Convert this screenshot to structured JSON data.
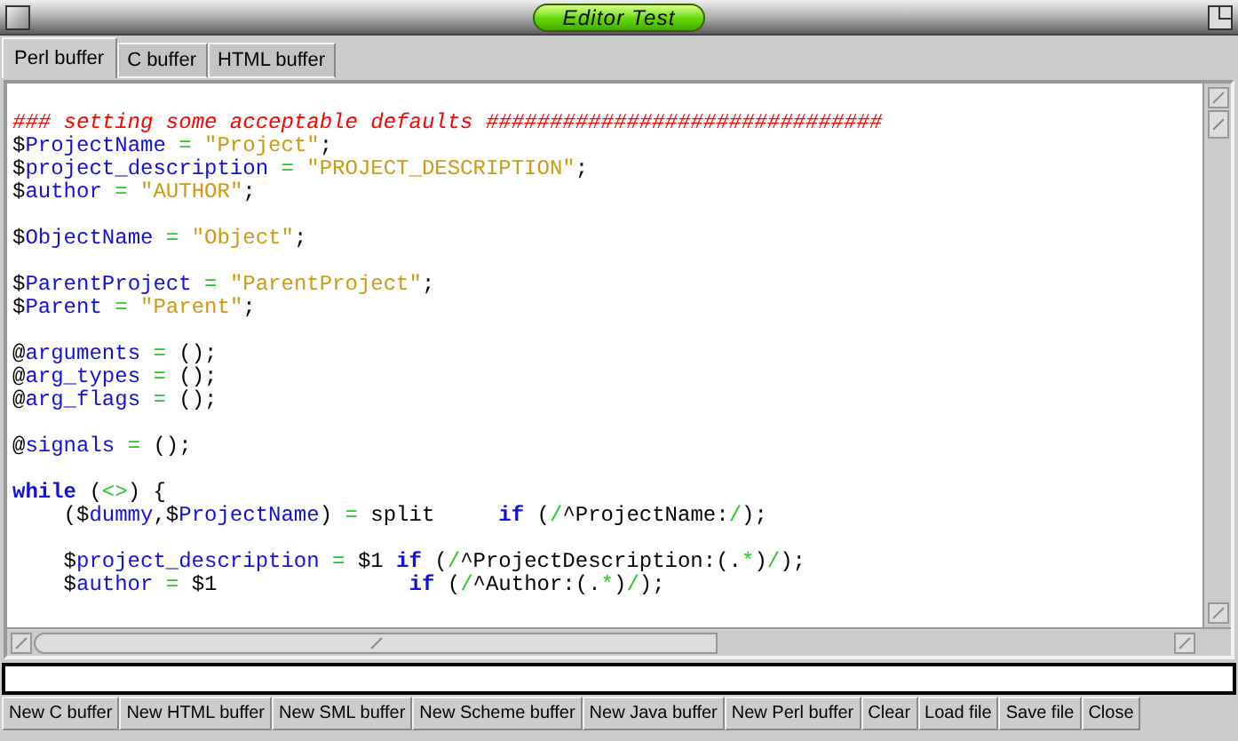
{
  "window": {
    "title": "Editor Test"
  },
  "tabs": [
    {
      "label": "Perl buffer",
      "selected": true
    },
    {
      "label": "C buffer",
      "selected": false
    },
    {
      "label": "HTML buffer",
      "selected": false
    }
  ],
  "code_lines": [
    {
      "kind": "code",
      "tokens": [
        {
          "kind": "comment",
          "text": "### setting some acceptable defaults ###############################"
        }
      ]
    },
    {
      "kind": "code",
      "tokens": [
        {
          "kind": "var",
          "text": "$ProjectName"
        },
        {
          "kind": "op",
          "text": " = "
        },
        {
          "kind": "str",
          "text": "\"Project\""
        },
        {
          "kind": "plain",
          "text": ";"
        }
      ]
    },
    {
      "kind": "code",
      "tokens": [
        {
          "kind": "var",
          "text": "$project_description"
        },
        {
          "kind": "op",
          "text": " = "
        },
        {
          "kind": "str",
          "text": "\"PROJECT_DESCRIPTION\""
        },
        {
          "kind": "plain",
          "text": ";"
        }
      ]
    },
    {
      "kind": "code",
      "tokens": [
        {
          "kind": "var",
          "text": "$author"
        },
        {
          "kind": "op",
          "text": " = "
        },
        {
          "kind": "str",
          "text": "\"AUTHOR\""
        },
        {
          "kind": "plain",
          "text": ";"
        }
      ]
    },
    {
      "kind": "blank"
    },
    {
      "kind": "code",
      "tokens": [
        {
          "kind": "var",
          "text": "$ObjectName"
        },
        {
          "kind": "op",
          "text": " = "
        },
        {
          "kind": "str",
          "text": "\"Object\""
        },
        {
          "kind": "plain",
          "text": ";"
        }
      ]
    },
    {
      "kind": "blank"
    },
    {
      "kind": "code",
      "tokens": [
        {
          "kind": "var",
          "text": "$ParentProject"
        },
        {
          "kind": "op",
          "text": " = "
        },
        {
          "kind": "str",
          "text": "\"ParentProject\""
        },
        {
          "kind": "plain",
          "text": ";"
        }
      ]
    },
    {
      "kind": "code",
      "tokens": [
        {
          "kind": "var",
          "text": "$Parent"
        },
        {
          "kind": "op",
          "text": " = "
        },
        {
          "kind": "str",
          "text": "\"Parent\""
        },
        {
          "kind": "plain",
          "text": ";"
        }
      ]
    },
    {
      "kind": "blank"
    },
    {
      "kind": "code",
      "tokens": [
        {
          "kind": "var",
          "text": "@arguments"
        },
        {
          "kind": "op",
          "text": " = "
        },
        {
          "kind": "plain",
          "text": "();"
        }
      ]
    },
    {
      "kind": "code",
      "tokens": [
        {
          "kind": "var",
          "text": "@arg_types"
        },
        {
          "kind": "op",
          "text": " = "
        },
        {
          "kind": "plain",
          "text": "();"
        }
      ]
    },
    {
      "kind": "code",
      "tokens": [
        {
          "kind": "var",
          "text": "@arg_flags"
        },
        {
          "kind": "op",
          "text": " = "
        },
        {
          "kind": "plain",
          "text": "();"
        }
      ]
    },
    {
      "kind": "blank"
    },
    {
      "kind": "code",
      "tokens": [
        {
          "kind": "var",
          "text": "@signals"
        },
        {
          "kind": "op",
          "text": " = "
        },
        {
          "kind": "plain",
          "text": "();"
        }
      ]
    },
    {
      "kind": "blank"
    },
    {
      "kind": "code",
      "tokens": [
        {
          "kind": "kw",
          "text": "while"
        },
        {
          "kind": "plain",
          "text": " ("
        },
        {
          "kind": "op",
          "text": "<>"
        },
        {
          "kind": "plain",
          "text": ") {"
        }
      ]
    },
    {
      "kind": "indented",
      "tokens": [
        {
          "kind": "plain",
          "text": "("
        },
        {
          "kind": "var",
          "text": "$dummy"
        },
        {
          "kind": "plain",
          "text": ","
        },
        {
          "kind": "var",
          "text": "$ProjectName"
        },
        {
          "kind": "plain",
          "text": ")"
        },
        {
          "kind": "op",
          "text": " = "
        },
        {
          "kind": "plain",
          "text": "split     "
        },
        {
          "kind": "kw",
          "text": "if"
        },
        {
          "kind": "plain",
          "text": " ("
        },
        {
          "kind": "op",
          "text": "/"
        },
        {
          "kind": "plain",
          "text": "^ProjectName:"
        },
        {
          "kind": "op",
          "text": "/"
        },
        {
          "kind": "plain",
          "text": ");"
        }
      ]
    },
    {
      "kind": "blank"
    },
    {
      "kind": "indented",
      "tokens": [
        {
          "kind": "var",
          "text": "$project_description"
        },
        {
          "kind": "op",
          "text": " = "
        },
        {
          "kind": "plain",
          "text": "$1 "
        },
        {
          "kind": "kw",
          "text": "if"
        },
        {
          "kind": "plain",
          "text": " ("
        },
        {
          "kind": "op",
          "text": "/"
        },
        {
          "kind": "plain",
          "text": "^ProjectDescription:(."
        },
        {
          "kind": "op",
          "text": "*"
        },
        {
          "kind": "plain",
          "text": ")"
        },
        {
          "kind": "op",
          "text": "/"
        },
        {
          "kind": "plain",
          "text": ");"
        }
      ]
    },
    {
      "kind": "indented",
      "tokens": [
        {
          "kind": "var",
          "text": "$author"
        },
        {
          "kind": "op",
          "text": " = "
        },
        {
          "kind": "plain",
          "text": "$1               "
        },
        {
          "kind": "kw",
          "text": "if"
        },
        {
          "kind": "plain",
          "text": " ("
        },
        {
          "kind": "op",
          "text": "/"
        },
        {
          "kind": "plain",
          "text": "^Author:(."
        },
        {
          "kind": "op",
          "text": "*"
        },
        {
          "kind": "plain",
          "text": ")"
        },
        {
          "kind": "op",
          "text": "/"
        },
        {
          "kind": "plain",
          "text": ");"
        }
      ]
    }
  ],
  "buttons": [
    "New C buffer",
    "New HTML buffer",
    "New SML buffer",
    "New Scheme buffer",
    "New Java buffer",
    "New Perl buffer",
    "Clear",
    "Load file",
    "Save file",
    "Close"
  ]
}
